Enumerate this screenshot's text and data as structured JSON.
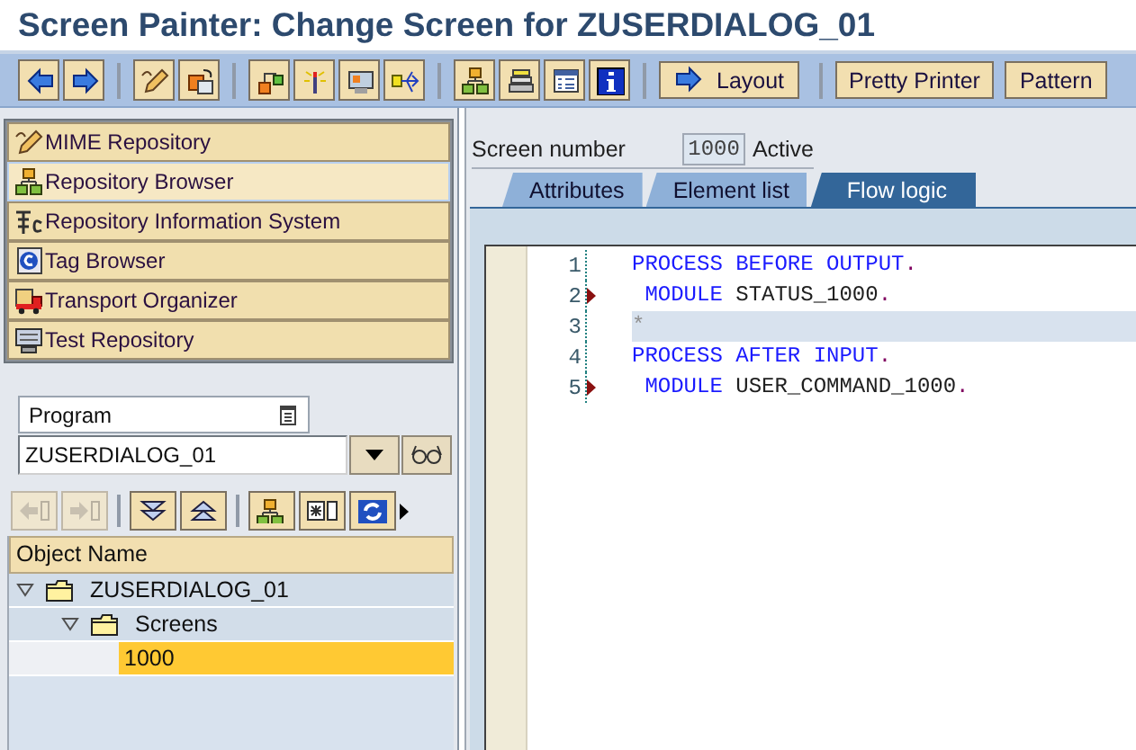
{
  "window": {
    "title": "Screen Painter: Change Screen for ZUSERDIALOG_01"
  },
  "toolbar": {
    "text_buttons": [
      {
        "label": "Layout",
        "kind": "arrow"
      },
      {
        "label": "Pretty Printer",
        "kind": "plain"
      },
      {
        "label": "Pattern",
        "kind": "plain"
      }
    ]
  },
  "navigation": {
    "items": [
      {
        "label": "MIME Repository",
        "selected": false
      },
      {
        "label": "Repository Browser",
        "selected": true
      },
      {
        "label": "Repository Information System",
        "selected": false
      },
      {
        "label": "Tag Browser",
        "selected": false
      },
      {
        "label": "Transport Organizer",
        "selected": false
      },
      {
        "label": "Test Repository",
        "selected": false
      }
    ]
  },
  "object_selection": {
    "type": "Program",
    "name": "ZUSERDIALOG_01"
  },
  "object_list": {
    "column": "Object Name",
    "nodes": [
      {
        "label": "ZUSERDIALOG_01",
        "expanded": true,
        "selected": false,
        "children": [
          {
            "label": "Screens",
            "expanded": true,
            "selected": false,
            "children": [
              {
                "label": "1000",
                "selected": true
              }
            ]
          }
        ]
      }
    ]
  },
  "screen_header": {
    "label": "Screen number",
    "number": "1000",
    "status": "Active"
  },
  "tabs": [
    {
      "label": "Attributes",
      "selected": false
    },
    {
      "label": "Element list",
      "selected": false
    },
    {
      "label": "Flow logic",
      "selected": true
    }
  ],
  "editor": {
    "lines": [
      {
        "number": "1",
        "breakpoint": false,
        "current": false,
        "tokens": [
          {
            "kind": "keyword",
            "text": "PROCESS BEFORE OUTPUT"
          },
          {
            "kind": "punct",
            "text": "."
          }
        ]
      },
      {
        "number": "2",
        "breakpoint": true,
        "current": false,
        "tokens": [
          {
            "kind": "keyword",
            "text": " MODULE"
          },
          {
            "kind": "ident",
            "text": " STATUS_1000"
          },
          {
            "kind": "punct",
            "text": "."
          }
        ]
      },
      {
        "number": "3",
        "breakpoint": false,
        "current": true,
        "tokens": [
          {
            "kind": "comment",
            "text": "*"
          }
        ]
      },
      {
        "number": "4",
        "breakpoint": false,
        "current": false,
        "tokens": [
          {
            "kind": "keyword",
            "text": "PROCESS AFTER INPUT"
          },
          {
            "kind": "punct",
            "text": "."
          }
        ]
      },
      {
        "number": "5",
        "breakpoint": true,
        "current": false,
        "tokens": [
          {
            "kind": "keyword",
            "text": " MODULE"
          },
          {
            "kind": "ident",
            "text": " USER_COMMAND_1000"
          },
          {
            "kind": "punct",
            "text": "."
          }
        ]
      }
    ]
  }
}
